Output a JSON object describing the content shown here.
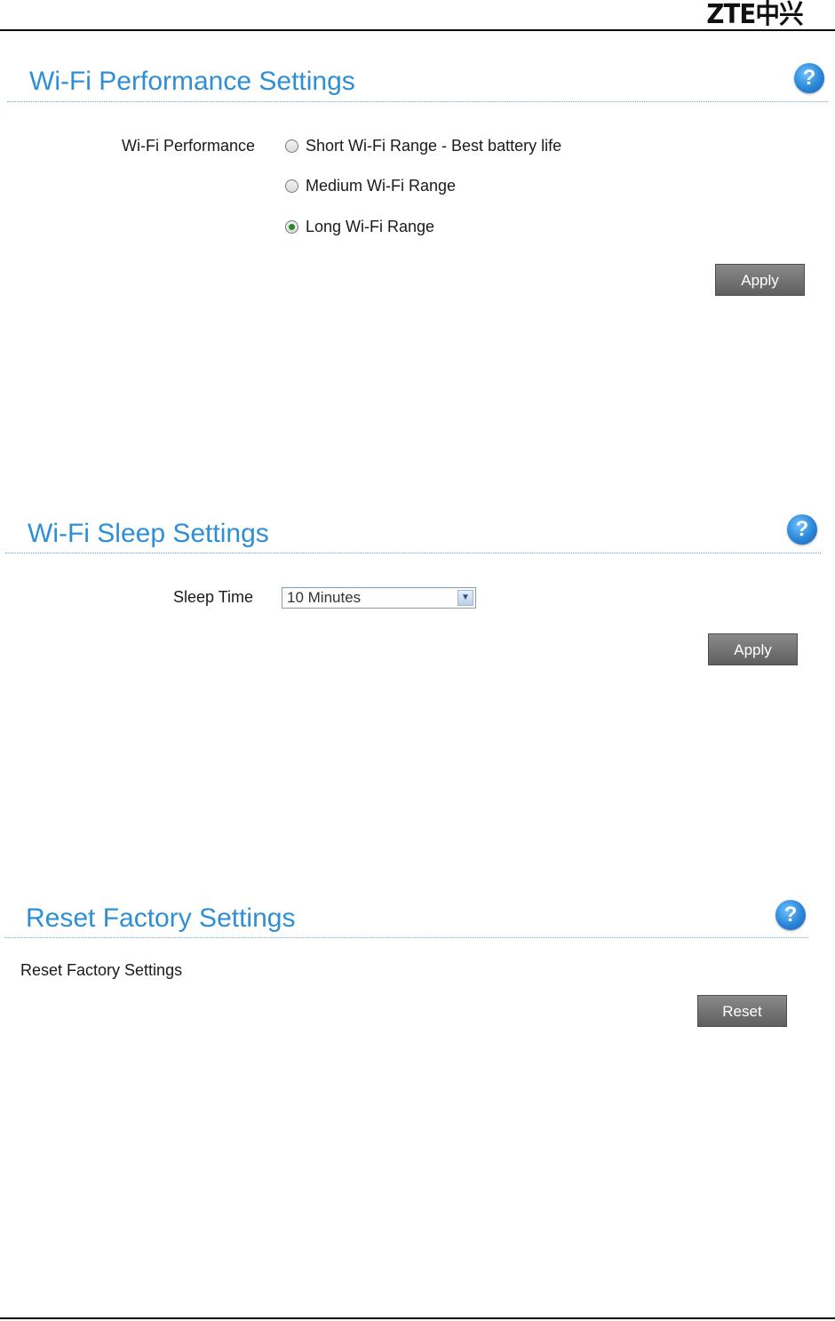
{
  "header": {
    "logo_text": "ZTE中兴"
  },
  "sections": {
    "performance": {
      "title": "Wi-Fi Performance Settings",
      "help": "?",
      "field_label": "Wi-Fi Performance",
      "options": [
        {
          "label": "Short Wi-Fi Range - Best battery life",
          "checked": false
        },
        {
          "label": "Medium Wi-Fi Range",
          "checked": false
        },
        {
          "label": "Long Wi-Fi Range",
          "checked": true
        }
      ],
      "apply_label": "Apply"
    },
    "sleep": {
      "title": "Wi-Fi Sleep Settings",
      "help": "?",
      "field_label": "Sleep Time",
      "selected": "10 Minutes",
      "apply_label": "Apply"
    },
    "reset": {
      "title": "Reset Factory Settings",
      "help": "?",
      "description": "Reset Factory Settings",
      "reset_label": "Reset"
    }
  },
  "colors": {
    "title": "#2e8fd6",
    "button": "#6f6f6f",
    "radio_checked": "#2a8a2a"
  }
}
